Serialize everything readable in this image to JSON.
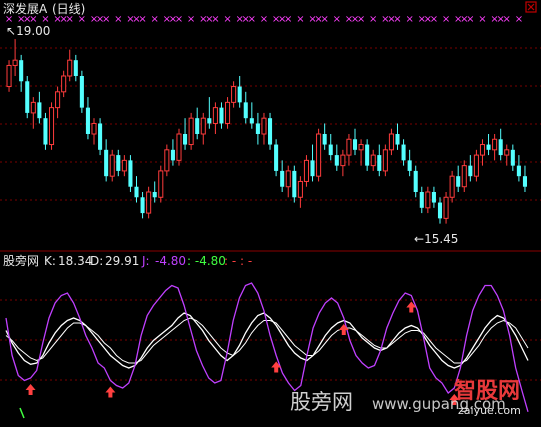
{
  "header": {
    "title": "深发展A",
    "period": "(日线)"
  },
  "price_panel": {
    "high_label": "19.00",
    "low_label": "15.45",
    "marker_color": "#ff40ff"
  },
  "indicator_panel": {
    "name": "股旁网",
    "k_label": "K:",
    "k_value": "18.34",
    "d_label": "D:",
    "d_value": "29.91",
    "j_label": "J:",
    "j_value": "-4.80",
    "extra_value": ": -4.80",
    "dash_text": ": - : -",
    "colors": {
      "k": "#ffffff",
      "d": "#ffffff",
      "j": "#c040ff",
      "extra": "#40ff40",
      "arrow": "#ff4040"
    }
  },
  "watermark": {
    "left_text": "股旁网",
    "url_text": "www.gupang.com",
    "brand_text": "智股网",
    "brand_url": "zaiyue.com"
  },
  "chart_data": [
    {
      "type": "candlestick",
      "title": "深发展A (日线)",
      "ylim": [
        15.0,
        19.4
      ],
      "annotations": [
        {
          "label": "19.00",
          "x": 1,
          "y": 19.0
        },
        {
          "label": "15.45",
          "x": 83,
          "y": 15.45
        }
      ],
      "ohlc": [
        [
          18.1,
          18.6,
          18.0,
          18.5
        ],
        [
          18.5,
          19.0,
          18.3,
          18.6
        ],
        [
          18.6,
          18.7,
          18.0,
          18.2
        ],
        [
          18.2,
          18.3,
          17.5,
          17.6
        ],
        [
          17.6,
          17.9,
          17.3,
          17.8
        ],
        [
          17.8,
          18.0,
          17.4,
          17.5
        ],
        [
          17.5,
          17.6,
          16.9,
          17.0
        ],
        [
          17.0,
          17.8,
          16.9,
          17.7
        ],
        [
          17.7,
          18.1,
          17.5,
          18.0
        ],
        [
          18.0,
          18.4,
          17.9,
          18.3
        ],
        [
          18.3,
          18.8,
          18.2,
          18.6
        ],
        [
          18.6,
          18.7,
          18.2,
          18.3
        ],
        [
          18.3,
          18.4,
          17.6,
          17.7
        ],
        [
          17.7,
          17.9,
          17.1,
          17.2
        ],
        [
          17.2,
          17.5,
          17.0,
          17.4
        ],
        [
          17.4,
          17.5,
          16.8,
          16.9
        ],
        [
          16.9,
          17.1,
          16.3,
          16.4
        ],
        [
          16.4,
          16.9,
          16.3,
          16.8
        ],
        [
          16.8,
          16.9,
          16.4,
          16.5
        ],
        [
          16.5,
          16.8,
          16.4,
          16.7
        ],
        [
          16.7,
          16.8,
          16.1,
          16.2
        ],
        [
          16.2,
          16.4,
          15.9,
          16.0
        ],
        [
          16.0,
          16.1,
          15.6,
          15.7
        ],
        [
          15.7,
          16.2,
          15.6,
          16.1
        ],
        [
          16.1,
          16.3,
          15.9,
          16.0
        ],
        [
          16.0,
          16.6,
          15.9,
          16.5
        ],
        [
          16.5,
          17.0,
          16.4,
          16.9
        ],
        [
          16.9,
          17.1,
          16.6,
          16.7
        ],
        [
          16.7,
          17.3,
          16.6,
          17.2
        ],
        [
          17.2,
          17.5,
          16.9,
          17.0
        ],
        [
          17.0,
          17.6,
          16.9,
          17.5
        ],
        [
          17.5,
          17.7,
          17.1,
          17.2
        ],
        [
          17.2,
          17.6,
          17.0,
          17.5
        ],
        [
          17.5,
          17.9,
          17.3,
          17.4
        ],
        [
          17.4,
          17.8,
          17.2,
          17.7
        ],
        [
          17.7,
          17.8,
          17.3,
          17.4
        ],
        [
          17.4,
          17.9,
          17.3,
          17.8
        ],
        [
          17.8,
          18.2,
          17.7,
          18.1
        ],
        [
          18.1,
          18.3,
          17.7,
          17.8
        ],
        [
          17.8,
          18.0,
          17.4,
          17.5
        ],
        [
          17.5,
          17.8,
          17.3,
          17.4
        ],
        [
          17.4,
          17.6,
          17.0,
          17.2
        ],
        [
          17.2,
          17.6,
          17.0,
          17.5
        ],
        [
          17.5,
          17.6,
          16.9,
          17.0
        ],
        [
          17.0,
          17.1,
          16.4,
          16.5
        ],
        [
          16.5,
          16.7,
          16.1,
          16.2
        ],
        [
          16.2,
          16.6,
          16.0,
          16.5
        ],
        [
          16.5,
          16.6,
          15.9,
          16.0
        ],
        [
          16.0,
          16.4,
          15.8,
          16.3
        ],
        [
          16.3,
          16.8,
          16.2,
          16.7
        ],
        [
          16.7,
          17.0,
          16.3,
          16.4
        ],
        [
          16.4,
          17.3,
          16.3,
          17.2
        ],
        [
          17.2,
          17.4,
          16.9,
          17.0
        ],
        [
          17.0,
          17.2,
          16.7,
          16.8
        ],
        [
          16.8,
          17.0,
          16.5,
          16.6
        ],
        [
          16.6,
          16.9,
          16.4,
          16.8
        ],
        [
          16.8,
          17.2,
          16.6,
          17.1
        ],
        [
          17.1,
          17.3,
          16.8,
          16.9
        ],
        [
          16.9,
          17.1,
          16.6,
          17.0
        ],
        [
          17.0,
          17.1,
          16.5,
          16.6
        ],
        [
          16.6,
          16.9,
          16.5,
          16.8
        ],
        [
          16.8,
          17.0,
          16.4,
          16.5
        ],
        [
          16.5,
          17.0,
          16.4,
          16.9
        ],
        [
          16.9,
          17.3,
          16.8,
          17.2
        ],
        [
          17.2,
          17.4,
          16.9,
          17.0
        ],
        [
          17.0,
          17.1,
          16.6,
          16.7
        ],
        [
          16.7,
          16.9,
          16.4,
          16.5
        ],
        [
          16.5,
          16.6,
          16.0,
          16.1
        ],
        [
          16.1,
          16.2,
          15.7,
          15.8
        ],
        [
          15.8,
          16.2,
          15.7,
          16.1
        ],
        [
          16.1,
          16.2,
          15.8,
          15.9
        ],
        [
          15.9,
          16.0,
          15.5,
          15.6
        ],
        [
          15.6,
          16.1,
          15.5,
          16.0
        ],
        [
          16.0,
          16.5,
          15.9,
          16.4
        ],
        [
          16.4,
          16.6,
          16.1,
          16.2
        ],
        [
          16.2,
          16.7,
          16.1,
          16.6
        ],
        [
          16.6,
          16.8,
          16.3,
          16.4
        ],
        [
          16.4,
          16.9,
          16.3,
          16.8
        ],
        [
          16.8,
          17.1,
          16.6,
          17.0
        ],
        [
          17.0,
          17.2,
          16.8,
          16.9
        ],
        [
          16.9,
          17.2,
          16.7,
          17.1
        ],
        [
          17.1,
          17.3,
          16.7,
          16.8
        ],
        [
          16.8,
          17.0,
          16.6,
          16.9
        ],
        [
          16.9,
          17.0,
          16.5,
          16.6
        ],
        [
          16.6,
          16.8,
          16.3,
          16.4
        ],
        [
          16.4,
          16.6,
          16.1,
          16.2
        ]
      ]
    },
    {
      "type": "line",
      "title": "股旁网",
      "ylim": [
        -10,
        110
      ],
      "series": [
        {
          "name": "K",
          "values": [
            60,
            50,
            42,
            36,
            33,
            34,
            40,
            50,
            58,
            64,
            68,
            70,
            68,
            64,
            58,
            52,
            46,
            40,
            36,
            32,
            30,
            32,
            38,
            46,
            52,
            56,
            60,
            64,
            70,
            74,
            72,
            66,
            60,
            52,
            46,
            40,
            36,
            40,
            48,
            58,
            66,
            72,
            74,
            70,
            64,
            56,
            48,
            42,
            38,
            36,
            40,
            48,
            56,
            62,
            66,
            68,
            66,
            60,
            54,
            50,
            46,
            44,
            46,
            52,
            58,
            62,
            64,
            62,
            56,
            48,
            42,
            36,
            32,
            30,
            32,
            38,
            46,
            54,
            62,
            68,
            72,
            70,
            64,
            56,
            46,
            36
          ]
        },
        {
          "name": "D",
          "values": [
            56,
            52,
            46,
            42,
            38,
            36,
            38,
            44,
            50,
            56,
            62,
            66,
            66,
            64,
            60,
            56,
            50,
            46,
            40,
            36,
            34,
            34,
            36,
            42,
            48,
            52,
            56,
            60,
            64,
            68,
            70,
            68,
            64,
            58,
            52,
            46,
            42,
            40,
            44,
            50,
            58,
            64,
            68,
            68,
            66,
            60,
            54,
            48,
            44,
            40,
            40,
            44,
            50,
            56,
            60,
            62,
            62,
            60,
            56,
            52,
            48,
            46,
            46,
            50,
            54,
            58,
            60,
            60,
            58,
            52,
            46,
            42,
            38,
            34,
            34,
            36,
            42,
            48,
            56,
            62,
            66,
            68,
            66,
            62,
            54,
            46
          ]
        },
        {
          "name": "J",
          "values": [
            70,
            40,
            24,
            20,
            22,
            28,
            50,
            70,
            82,
            88,
            90,
            82,
            70,
            56,
            46,
            34,
            30,
            20,
            16,
            14,
            18,
            32,
            56,
            72,
            80,
            86,
            92,
            96,
            94,
            80,
            62,
            44,
            32,
            22,
            18,
            20,
            42,
            68,
            86,
            96,
            98,
            90,
            76,
            56,
            40,
            26,
            18,
            12,
            16,
            40,
            62,
            74,
            82,
            86,
            82,
            70,
            52,
            40,
            34,
            30,
            32,
            44,
            62,
            74,
            84,
            90,
            88,
            76,
            54,
            30,
            22,
            18,
            10,
            14,
            30,
            56,
            76,
            88,
            96,
            96,
            88,
            76,
            56,
            30,
            12,
            -5
          ]
        }
      ],
      "arrows_at": [
        4,
        17,
        44,
        55,
        66,
        73
      ]
    }
  ]
}
